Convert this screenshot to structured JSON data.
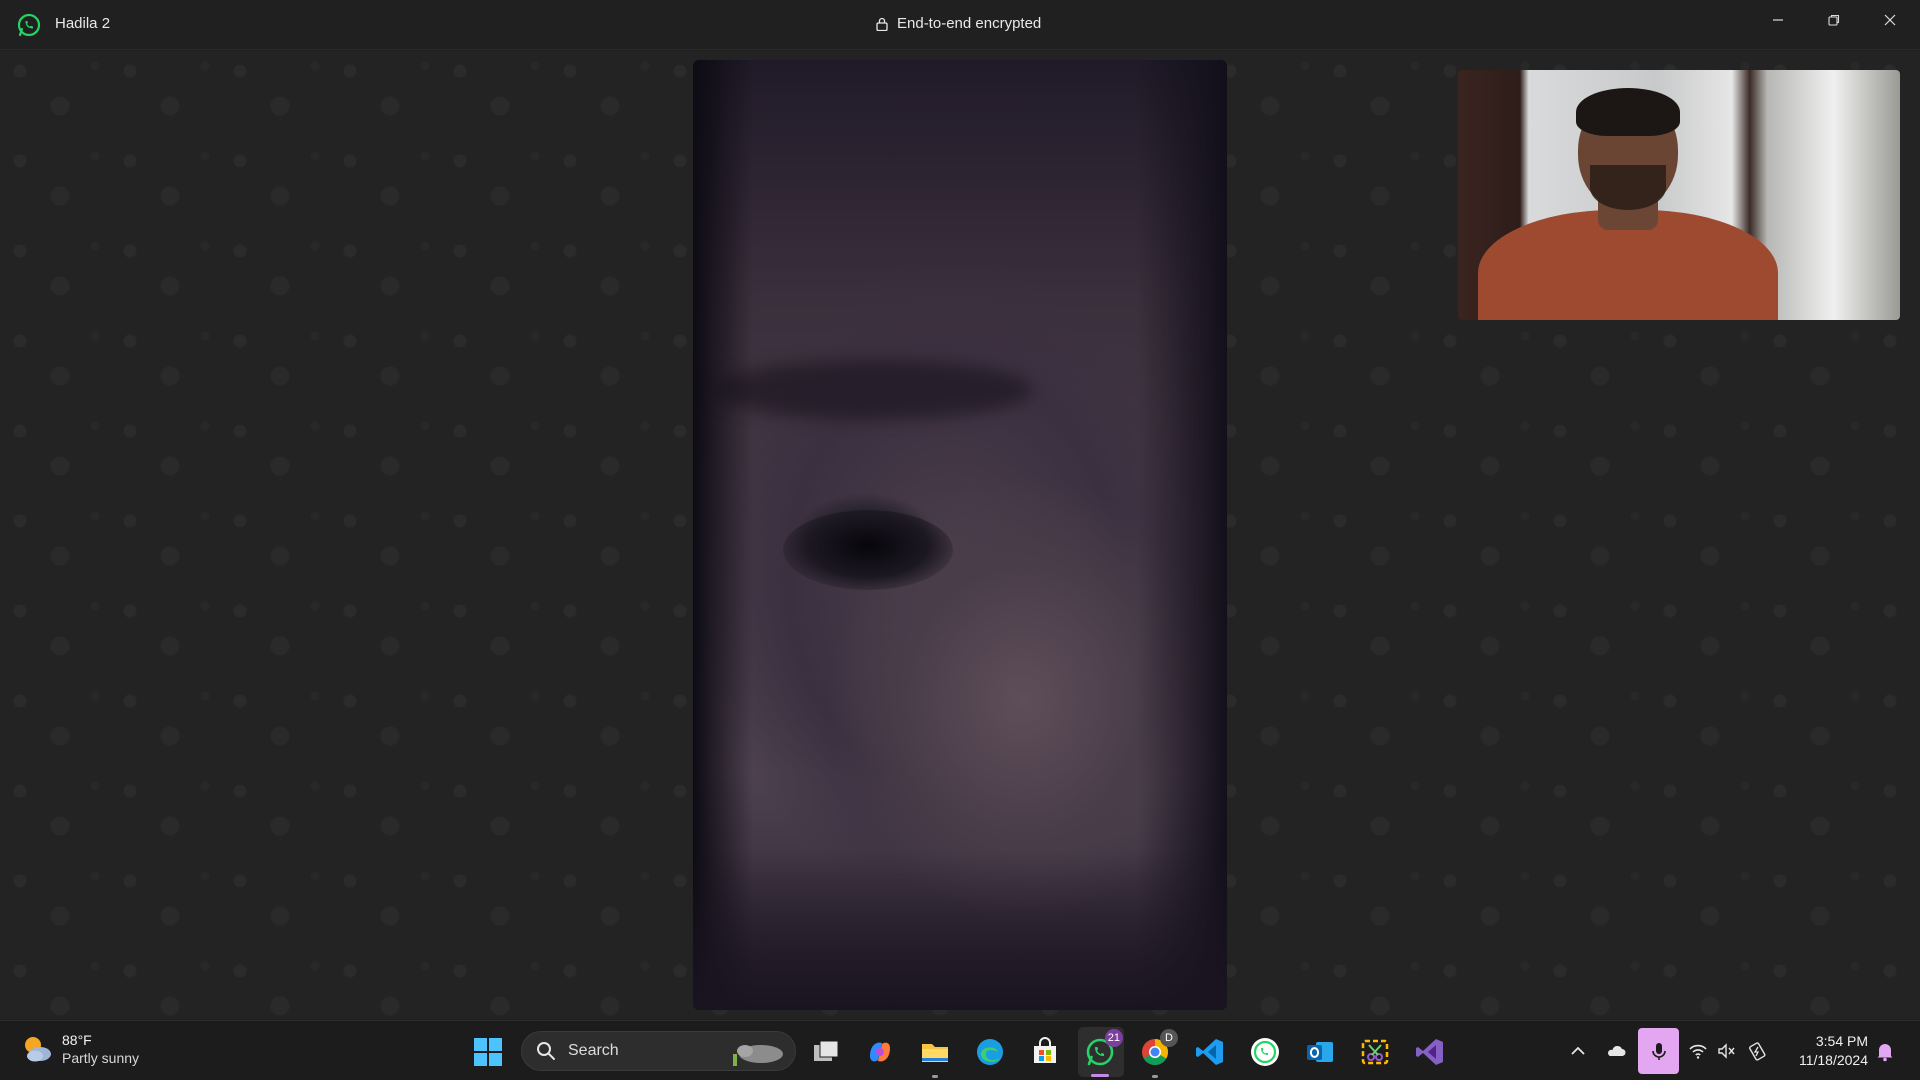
{
  "window": {
    "title": "Hadila 2",
    "encryption_label": "End-to-end encrypted",
    "controls": [
      "minimize-icon",
      "restore-icon",
      "close-icon"
    ]
  },
  "call": {
    "main_video": "remote participant video",
    "self_view": "local camera preview"
  },
  "taskbar": {
    "weather": {
      "temp": "88°F",
      "condition": "Partly sunny",
      "icon": "partly-sunny-icon"
    },
    "search": {
      "label": "Search"
    },
    "apps": [
      {
        "name": "task-view-icon"
      },
      {
        "name": "copilot-icon"
      },
      {
        "name": "file-explorer-icon"
      },
      {
        "name": "edge-icon"
      },
      {
        "name": "microsoft-store-icon"
      },
      {
        "name": "whatsapp-icon",
        "badge": "21",
        "active": true
      },
      {
        "name": "chrome-icon",
        "badge": "D"
      },
      {
        "name": "vscode-icon"
      },
      {
        "name": "whatsapp-alt-icon"
      },
      {
        "name": "outlook-icon"
      },
      {
        "name": "snipping-tool-icon"
      },
      {
        "name": "visual-studio-icon"
      }
    ],
    "tray": {
      "icons": [
        "chevron-up-icon",
        "onedrive-icon",
        "microphone-icon",
        "wifi-icon",
        "speaker-muted-icon",
        "battery-charging-icon"
      ],
      "time": "3:54 PM",
      "date": "11/18/2024"
    },
    "colors": {
      "accent": "#c58ae6",
      "mic_highlight": "#e3a6f0",
      "whatsapp_green": "#25d366"
    }
  }
}
